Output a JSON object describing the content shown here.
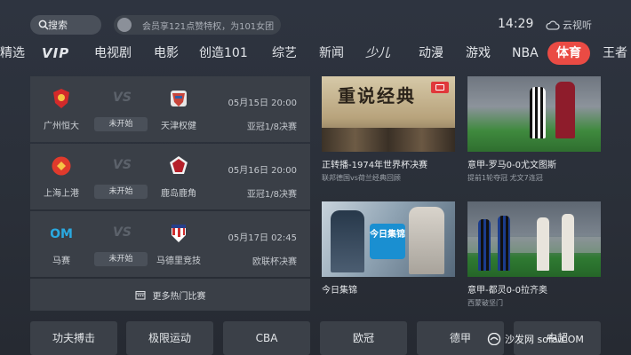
{
  "search": {
    "label": "搜索"
  },
  "vip_banner": {
    "text": "会员享121点赞特权，为101女团"
  },
  "clock": "14:29",
  "cloud": {
    "label": "云视听"
  },
  "nav": {
    "items": [
      {
        "label": "精选"
      },
      {
        "label": "VIP"
      },
      {
        "label": "电视剧"
      },
      {
        "label": "电影"
      },
      {
        "label": "创造101"
      },
      {
        "label": "综艺"
      },
      {
        "label": "新闻"
      },
      {
        "label": "少儿"
      },
      {
        "label": "动漫"
      },
      {
        "label": "游戏"
      },
      {
        "label": "NBA"
      },
      {
        "label": "体育"
      },
      {
        "label": "王者"
      }
    ],
    "active": "体育"
  },
  "matches": [
    {
      "home": "广州恒大",
      "away": "天津权健",
      "state": "未开始",
      "time": "05月15日 20:00",
      "stage": "亚冠1/8决赛",
      "home_color": "#d32a2a",
      "away_color": "#c8443a"
    },
    {
      "home": "上海上港",
      "away": "鹿岛鹿角",
      "state": "未开始",
      "time": "05月16日 20:00",
      "stage": "亚冠1/8决赛",
      "home_color": "#e03a2c",
      "away_color": "#b5202a"
    },
    {
      "home": "马赛",
      "away": "马德里竞技",
      "state": "未开始",
      "time": "05月17日 02:45",
      "stage": "欧联杯决赛",
      "home_color": "#2aa9e0",
      "away_color": "#cf2e2e"
    }
  ],
  "more_matches": "更多热门比赛",
  "vs_text": "VS",
  "cards": [
    {
      "title": "正转播-1974年世界杯决赛",
      "sub": "联邦德国vs荷兰经典回顾",
      "overlay": "重说经典"
    },
    {
      "title": "意甲-罗马0-0尤文图斯",
      "sub": "提前1轮夺冠 尤文7连冠",
      "overlay": ""
    },
    {
      "title": "今日集锦",
      "sub": "",
      "overlay": "今日集锦"
    },
    {
      "title": "意甲-都灵0-0拉齐奥",
      "sub": "西蒙破坚门",
      "overlay": ""
    }
  ],
  "tiles": [
    "功夫搏击",
    "极限运动",
    "CBA",
    "欧冠",
    "德甲",
    "中超"
  ],
  "watermark": "沙发网 sofa.COM"
}
